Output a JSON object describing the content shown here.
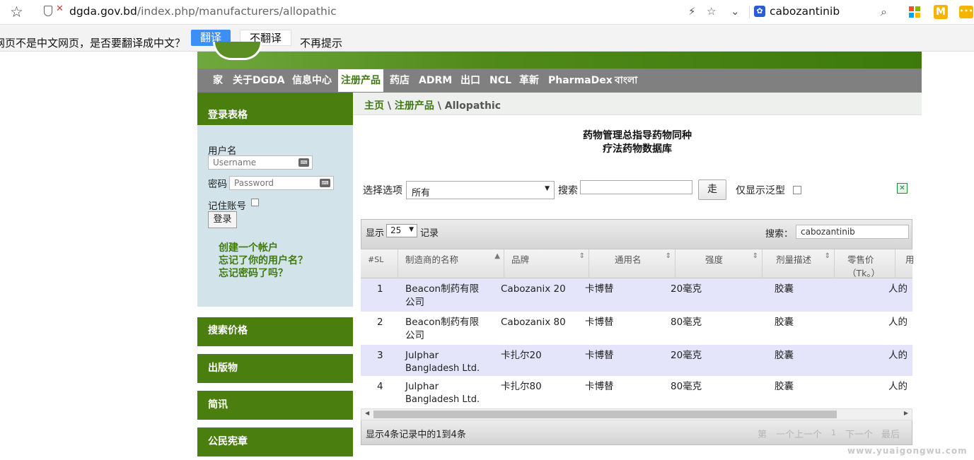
{
  "browser": {
    "url_domain": "dgda.gov.bd",
    "url_path": "/index.php/manufacturers/allopathic",
    "search_query": "cabozantinib",
    "translate_message": "网页不是中文网页，是否要翻译成中文？",
    "translate_button": "翻译",
    "no_translate_button": "不翻译",
    "never_prompt": "不再提示"
  },
  "nav": {
    "items": [
      "家",
      "关于DGDA",
      "信息中心",
      "注册产品",
      "药店",
      "ADRM",
      "出口",
      "NCL",
      "革新",
      "PharmaDex",
      "বাংলা"
    ],
    "active": "注册产品"
  },
  "login": {
    "title": "登录表格",
    "username_label": "用户名",
    "username_placeholder": "Username",
    "password_label": "密码",
    "password_placeholder": "Password",
    "remember_label": "记住账号",
    "login_button": "登录",
    "links": [
      "创建一个帐户",
      "忘记了你的用户名？",
      "忘记密码了吗？"
    ]
  },
  "side_menu": [
    "搜索价格",
    "出版物",
    "简讯",
    "公民宪章"
  ],
  "breadcrumb": {
    "home": "主页",
    "section": "注册产品",
    "current": "Allopathic"
  },
  "page_title": {
    "line1": "药物管理总指导药物同种",
    "line2": "疗法药物数据库"
  },
  "filter": {
    "select_label": "选择选项",
    "select_value": "所有",
    "search_label": "搜索",
    "go_button": "走",
    "generic_only_label": "仅显示泛型"
  },
  "table": {
    "show_label": "显示",
    "length_value": "25",
    "records_label": "记录",
    "search_label": "搜索：",
    "search_value": "cabozantinib",
    "columns": [
      "#SL",
      "制造商的名称",
      "品牌",
      "通用名",
      "强度",
      "剂量描述",
      "零售价",
      "（Tk。）",
      "用"
    ],
    "rows": [
      {
        "sl": "1",
        "mfr1": "Beacon制药有限",
        "mfr2": "公司",
        "brand": "Cabozanix 20",
        "generic": "卡博替",
        "strength": "20毫克",
        "dosage": "胶囊",
        "price": "人的"
      },
      {
        "sl": "2",
        "mfr1": "Beacon制药有限",
        "mfr2": "公司",
        "brand": "Cabozanix 80",
        "generic": "卡博替",
        "strength": "80毫克",
        "dosage": "胶囊",
        "price": "人的"
      },
      {
        "sl": "3",
        "mfr1": "Julphar",
        "mfr2": "Bangladesh Ltd.",
        "brand": "卡扎尔20",
        "generic": "卡博替",
        "strength": "20毫克",
        "dosage": "胶囊",
        "price": "人的"
      },
      {
        "sl": "4",
        "mfr1": "Julphar",
        "mfr2": "Bangladesh Ltd.",
        "brand": "卡扎尔80",
        "generic": "卡博替",
        "strength": "80毫克",
        "dosage": "胶囊",
        "price": "人的"
      }
    ],
    "info": "显示4条记录中的1到4条",
    "pager": {
      "first": "第",
      "prev": "一个上一个",
      "page": "1",
      "next": "下一个",
      "last": "最后"
    }
  },
  "watermark": "www.yuaigongwu.com"
}
